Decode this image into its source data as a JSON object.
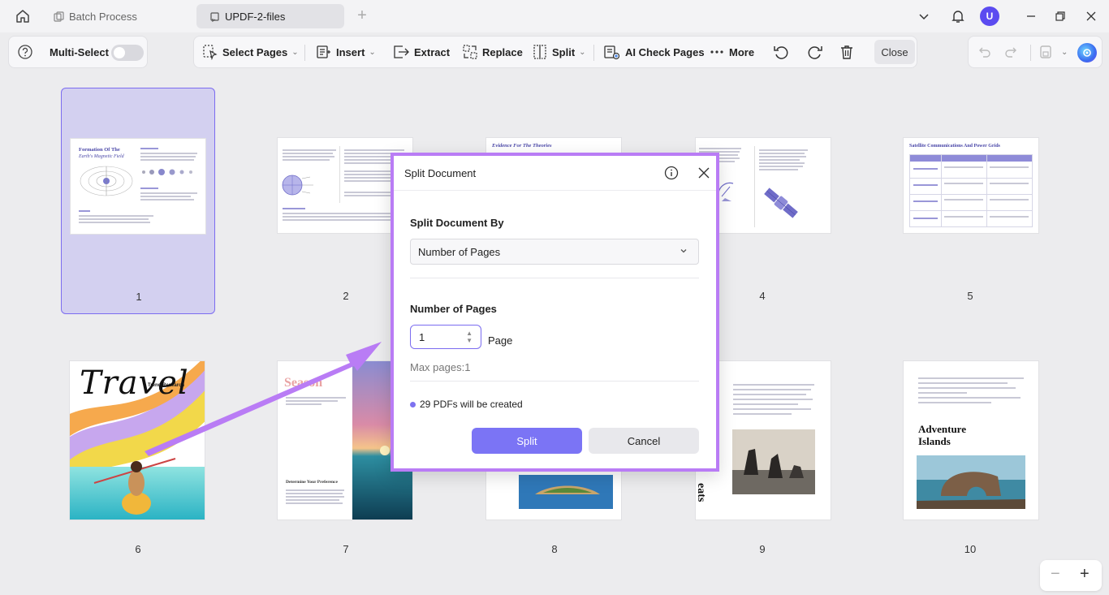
{
  "titlebar": {
    "tabs": [
      {
        "label": "Batch Process",
        "active": false
      },
      {
        "label": "UPDF-2-files",
        "active": true
      }
    ],
    "avatar_letter": "U"
  },
  "toolbar": {
    "multi_select_label": "Multi-Select",
    "multi_select_on": false,
    "items": {
      "select_pages": "Select Pages",
      "insert": "Insert",
      "extract": "Extract",
      "replace": "Replace",
      "split": "Split",
      "ai_check": "AI Check Pages",
      "more": "More",
      "close": "Close"
    }
  },
  "pages": [
    {
      "number": "1",
      "selected": true
    },
    {
      "number": "2",
      "selected": false
    },
    {
      "number": "4",
      "selected": false
    },
    {
      "number": "5",
      "selected": false
    },
    {
      "number": "6",
      "selected": false
    },
    {
      "number": "7",
      "selected": false
    },
    {
      "number": "8",
      "selected": false
    },
    {
      "number": "9",
      "selected": false
    },
    {
      "number": "10",
      "selected": false
    }
  ],
  "thumb_text": {
    "p1_title_a": "Formation Of The",
    "p1_title_b": "Earth's Magnetic Field",
    "p3_title": "Evidence For The Theories",
    "p5_title": "Satellite Communications And Power Grids",
    "p6_small": "Trend Research",
    "p6_big": "Travel",
    "p7_title": "Season",
    "p7_sub": "Determine Your Preference",
    "p9_side": "eats",
    "p10_title": "Adventure Islands"
  },
  "dialog": {
    "title": "Split Document",
    "split_by_label": "Split Document By",
    "split_by_value": "Number of Pages",
    "number_label": "Number of Pages",
    "number_value": "1",
    "unit": "Page",
    "max_pages": "Max pages:1",
    "note": "29 PDFs will be created",
    "split_button": "Split",
    "cancel_button": "Cancel"
  },
  "colors": {
    "accent": "#7b74f5",
    "dialog_border": "#b97cf5",
    "selection": "#d3d0f0"
  }
}
